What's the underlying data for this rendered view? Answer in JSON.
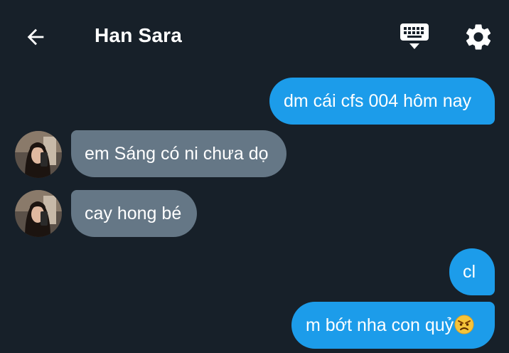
{
  "header": {
    "contact_name": "Han Sara",
    "back_icon": "arrow-left-icon",
    "keyboard_icon": "keyboard-icon",
    "settings_icon": "gear-icon"
  },
  "colors": {
    "background": "#172029",
    "outgoing_bubble": "#1c9cea",
    "incoming_bubble": "#657786",
    "text": "#ffffff"
  },
  "messages": [
    {
      "direction": "outgoing",
      "text": "dm cái cfs 004 hôm nay"
    },
    {
      "direction": "incoming",
      "text": "em Sáng có ni chưa dọ"
    },
    {
      "direction": "incoming",
      "text": "cay hong bé"
    },
    {
      "direction": "outgoing",
      "text": "cl"
    },
    {
      "direction": "outgoing",
      "text": "m bớt nha con quỷ",
      "trailing_emoji": "angry-face-emoji"
    }
  ]
}
